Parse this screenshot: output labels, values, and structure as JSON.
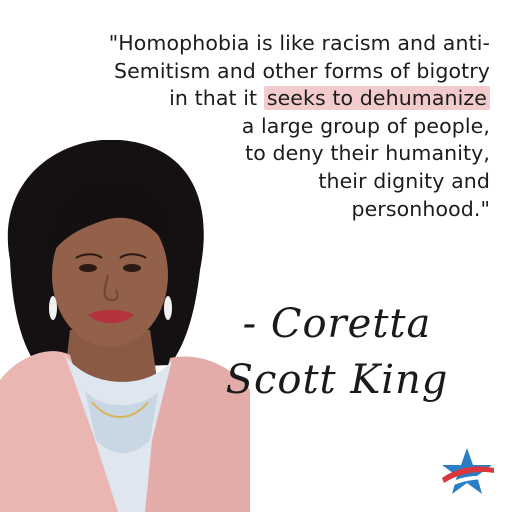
{
  "quote": {
    "line1": "\"Homophobia is like racism and anti-",
    "line2": "Semitism and other forms of bigotry",
    "line3_pre": "in that it ",
    "line3_highlight": "seeks to dehumanize",
    "line4": "a large group of people,",
    "line5": "to deny their humanity,",
    "line6": "their dignity and",
    "line7": "personhood.\""
  },
  "attribution": {
    "line1": "- Coretta",
    "line2": "Scott King"
  },
  "colors": {
    "highlight": "#f2cccd",
    "text": "#1c1c1c",
    "jacket": "#e9b6b2",
    "logo_red": "#d9363e",
    "logo_blue": "#2a7fc4"
  },
  "icons": {
    "logo": "star-logo-icon"
  }
}
